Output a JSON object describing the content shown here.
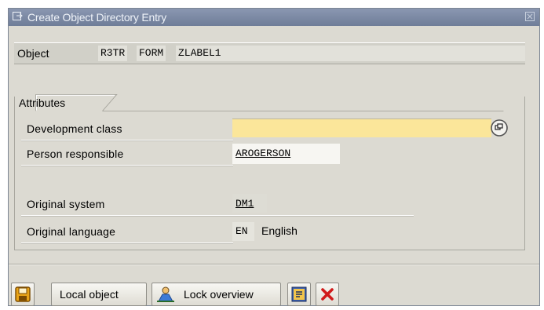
{
  "window": {
    "title": "Create Object Directory Entry"
  },
  "object": {
    "label": "Object",
    "pgmid": "R3TR",
    "type": "FORM",
    "name": "ZLABEL1"
  },
  "attributes": {
    "group_title": "Attributes",
    "development_class": {
      "label": "Development class",
      "value": ""
    },
    "person_responsible": {
      "label": "Person responsible",
      "value": "AROGERSON"
    },
    "original_system": {
      "label": "Original system",
      "value": "DM1"
    },
    "original_language": {
      "label": "Original language",
      "code": "EN",
      "name": "English"
    }
  },
  "toolbar": {
    "save_icon": "floppy-disk-icon",
    "local_object_label": "Local object",
    "lock_overview_label": "Lock overview",
    "lock_icon": "person-lock-icon",
    "display_icon": "display-icon",
    "cancel_icon": "red-x-cancel-icon"
  },
  "colors": {
    "titlebar": "#7886a2",
    "window_bg": "#dcdad2",
    "required_field": "#fbe69a",
    "cancel_red": "#d11a1a"
  }
}
